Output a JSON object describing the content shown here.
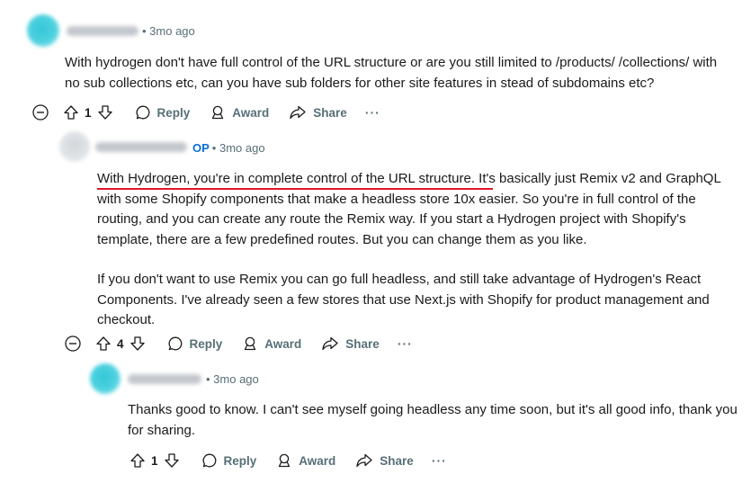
{
  "comments": [
    {
      "time": "3mo ago",
      "text": [
        "With hydrogen don't have full control of the URL structure or are you still limited to /products/ /collections/ with no sub collections etc, can you have sub folders for other site features in stead of subdomains etc?"
      ],
      "votes": "1"
    },
    {
      "op_badge": "OP",
      "time": "3mo ago",
      "text_underlined": "With Hydrogen, you're in complete control of the URL structure.",
      "text_rest": " It's basically just Remix v2 and GraphQL with some Shopify components that make a headless store 10x easier. So you're in full control of the routing, and you can create any route the Remix way. If you start a Hydrogen project with Shopify's template, there are a few predefined routes. But you can change them as you like.",
      "text_p2": "If you don't want to use Remix you can go full headless, and still take advantage of Hydrogen's React Components. I've already seen a few stores that use Next.js with Shopify for product management and checkout.",
      "votes": "4"
    },
    {
      "time": "3mo ago",
      "text": [
        "Thanks good to know. I can't see myself going headless any time soon, but it's all good info, thank you for sharing."
      ],
      "votes": "1"
    }
  ],
  "actions": {
    "reply": "Reply",
    "award": "Award",
    "share": "Share",
    "more": "···"
  },
  "colors": {
    "accent_op": "#0a6fd6",
    "underline": "#e0162b",
    "muted": "#576f76",
    "avatar": "#35c7d8"
  }
}
